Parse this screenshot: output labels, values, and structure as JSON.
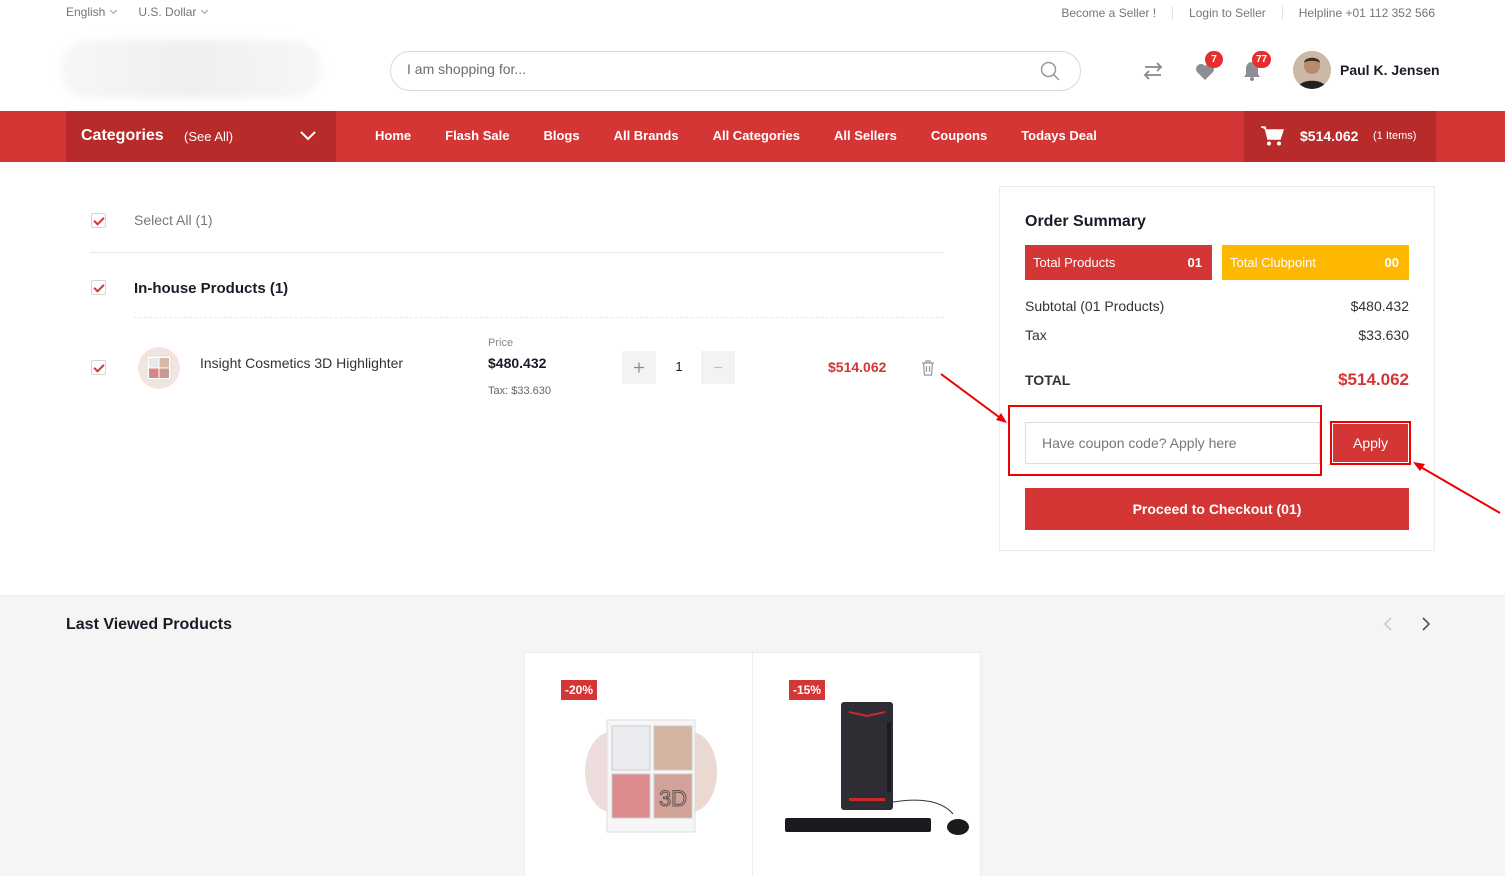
{
  "topbar": {
    "language": "English",
    "currency": "U.S. Dollar",
    "become_seller": "Become a Seller !",
    "login_seller": "Login to Seller",
    "helpline": "Helpline +01 112 352 566"
  },
  "header": {
    "search_placeholder": "I am shopping for...",
    "wishlist_count": "7",
    "notification_count": "77",
    "user_name": "Paul K. Jensen"
  },
  "nav": {
    "categories_label": "Categories",
    "see_all": "(See All)",
    "links": [
      "Home",
      "Flash Sale",
      "Blogs",
      "All Brands",
      "All Categories",
      "All Sellers",
      "Coupons",
      "Todays Deal"
    ],
    "cart_amount": "$514.062",
    "cart_items": "(1 Items)"
  },
  "cart": {
    "select_all": "Select All (1)",
    "group_title": "In-house Products (1)",
    "item": {
      "name": "Insight Cosmetics 3D Highlighter",
      "price_label": "Price",
      "price": "$480.432",
      "tax": "Tax: $33.630",
      "qty": "1",
      "total": "$514.062"
    }
  },
  "summary": {
    "title": "Order Summary",
    "total_products_label": "Total Products",
    "total_products_value": "01",
    "clubpoint_label": "Total Clubpoint",
    "clubpoint_value": "00",
    "subtotal_label": "Subtotal (01 Products)",
    "subtotal_value": "$480.432",
    "tax_label": "Tax",
    "tax_value": "$33.630",
    "total_label": "TOTAL",
    "total_value": "$514.062",
    "coupon_placeholder": "Have coupon code? Apply here",
    "apply_label": "Apply",
    "checkout_label": "Proceed to Checkout (01)"
  },
  "last_viewed": {
    "title": "Last Viewed Products",
    "products": [
      {
        "discount": "-20%"
      },
      {
        "discount": "-15%"
      }
    ]
  },
  "colors": {
    "primary": "#d43535",
    "dark_primary": "#b92a2a",
    "clubpoint": "#ffb800"
  }
}
